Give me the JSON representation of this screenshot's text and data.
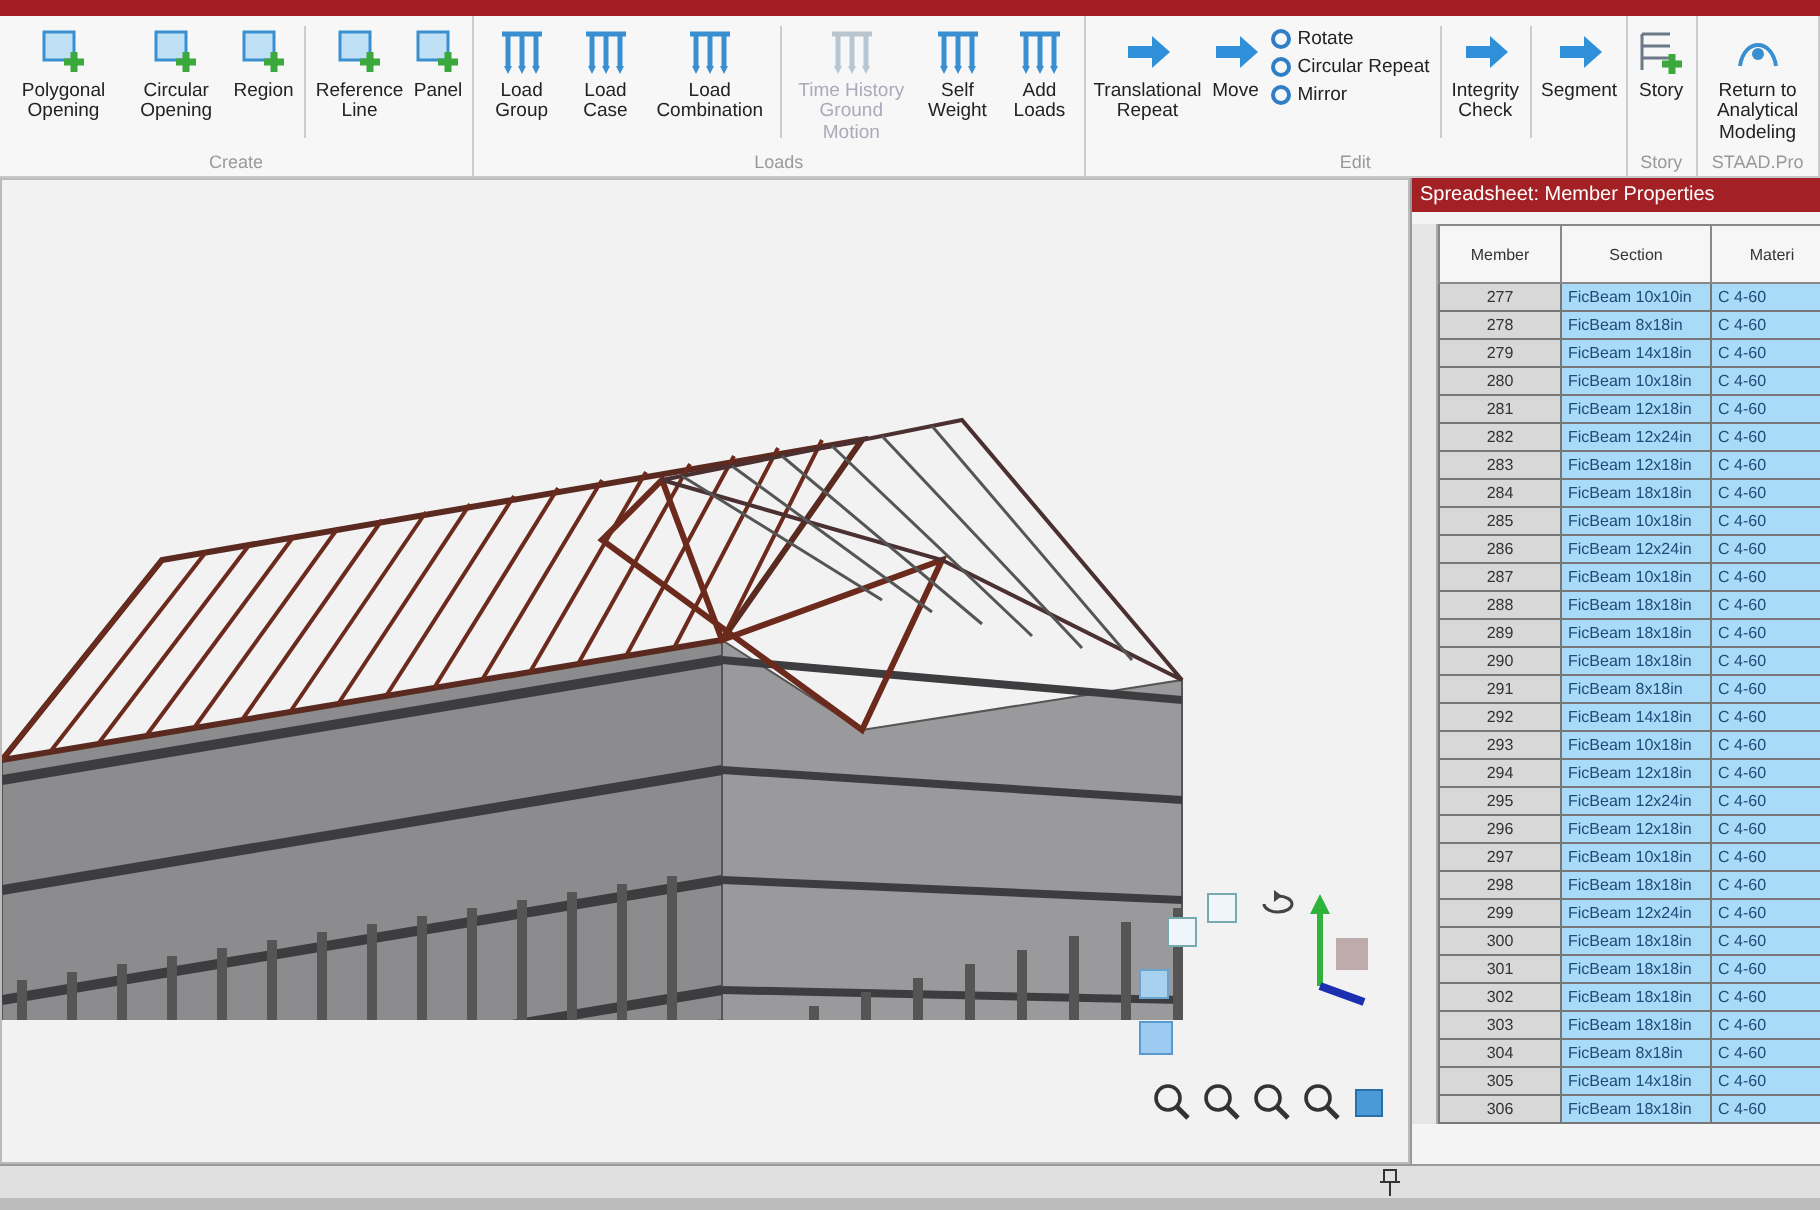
{
  "ribbon": {
    "groups": [
      {
        "label": "Create",
        "items": [
          {
            "kind": "large",
            "label": "Polygonal Opening",
            "disabled": false
          },
          {
            "kind": "large",
            "label": "Circular Opening",
            "disabled": false
          },
          {
            "kind": "large",
            "label": "Region",
            "disabled": false
          },
          {
            "kind": "separator"
          },
          {
            "kind": "large",
            "label": "Reference Line",
            "disabled": false
          },
          {
            "kind": "large",
            "label": "Panel",
            "disabled": false
          }
        ]
      },
      {
        "label": "Loads",
        "items": [
          {
            "kind": "large",
            "label": "Load Group",
            "disabled": false
          },
          {
            "kind": "large",
            "label": "Load Case",
            "disabled": false
          },
          {
            "kind": "large",
            "label": "Load Combination",
            "disabled": false
          },
          {
            "kind": "separator"
          },
          {
            "kind": "large",
            "label": "Time History Ground Motion",
            "disabled": true
          },
          {
            "kind": "large",
            "label": "Self Weight",
            "disabled": false
          },
          {
            "kind": "large",
            "label": "Add Loads",
            "disabled": false
          }
        ]
      },
      {
        "label": "Edit",
        "items": [
          {
            "kind": "large",
            "label": "Translational Repeat",
            "disabled": false
          },
          {
            "kind": "large",
            "label": "Move",
            "disabled": false
          },
          {
            "kind": "stack",
            "items": [
              "Rotate",
              "Circular Repeat",
              "Mirror"
            ]
          },
          {
            "kind": "separator"
          },
          {
            "kind": "large",
            "label": "Integrity Check",
            "disabled": false
          },
          {
            "kind": "separator"
          },
          {
            "kind": "large",
            "label": "Segment",
            "disabled": false
          }
        ]
      },
      {
        "label": "Story",
        "items": [
          {
            "kind": "large",
            "label": "Story",
            "disabled": false
          }
        ]
      },
      {
        "label": "STAAD.Pro",
        "items": [
          {
            "kind": "large",
            "label": "Return to Analytical Modeling",
            "disabled": false
          }
        ]
      }
    ]
  },
  "spreadsheet": {
    "title": "Spreadsheet: Member Properties",
    "columns": [
      "Member",
      "Section",
      "Materi"
    ],
    "rows": [
      [
        "277",
        "FicBeam 10x10in",
        "C 4-60"
      ],
      [
        "278",
        "FicBeam 8x18in",
        "C 4-60"
      ],
      [
        "279",
        "FicBeam 14x18in",
        "C 4-60"
      ],
      [
        "280",
        "FicBeam 10x18in",
        "C 4-60"
      ],
      [
        "281",
        "FicBeam 12x18in",
        "C 4-60"
      ],
      [
        "282",
        "FicBeam 12x24in",
        "C 4-60"
      ],
      [
        "283",
        "FicBeam 12x18in",
        "C 4-60"
      ],
      [
        "284",
        "FicBeam 18x18in",
        "C 4-60"
      ],
      [
        "285",
        "FicBeam 10x18in",
        "C 4-60"
      ],
      [
        "286",
        "FicBeam 12x24in",
        "C 4-60"
      ],
      [
        "287",
        "FicBeam 10x18in",
        "C 4-60"
      ],
      [
        "288",
        "FicBeam 18x18in",
        "C 4-60"
      ],
      [
        "289",
        "FicBeam 18x18in",
        "C 4-60"
      ],
      [
        "290",
        "FicBeam 18x18in",
        "C 4-60"
      ],
      [
        "291",
        "FicBeam 8x18in",
        "C 4-60"
      ],
      [
        "292",
        "FicBeam 14x18in",
        "C 4-60"
      ],
      [
        "293",
        "FicBeam 10x18in",
        "C 4-60"
      ],
      [
        "294",
        "FicBeam 12x18in",
        "C 4-60"
      ],
      [
        "295",
        "FicBeam 12x24in",
        "C 4-60"
      ],
      [
        "296",
        "FicBeam 12x18in",
        "C 4-60"
      ],
      [
        "297",
        "FicBeam 10x18in",
        "C 4-60"
      ],
      [
        "298",
        "FicBeam 18x18in",
        "C 4-60"
      ],
      [
        "299",
        "FicBeam 12x24in",
        "C 4-60"
      ],
      [
        "300",
        "FicBeam 18x18in",
        "C 4-60"
      ],
      [
        "301",
        "FicBeam 18x18in",
        "C 4-60"
      ],
      [
        "302",
        "FicBeam 18x18in",
        "C 4-60"
      ],
      [
        "303",
        "FicBeam 18x18in",
        "C 4-60"
      ],
      [
        "304",
        "FicBeam 8x18in",
        "C 4-60"
      ],
      [
        "305",
        "FicBeam 14x18in",
        "C 4-60"
      ],
      [
        "306",
        "FicBeam 18x18in",
        "C 4-60"
      ]
    ]
  }
}
